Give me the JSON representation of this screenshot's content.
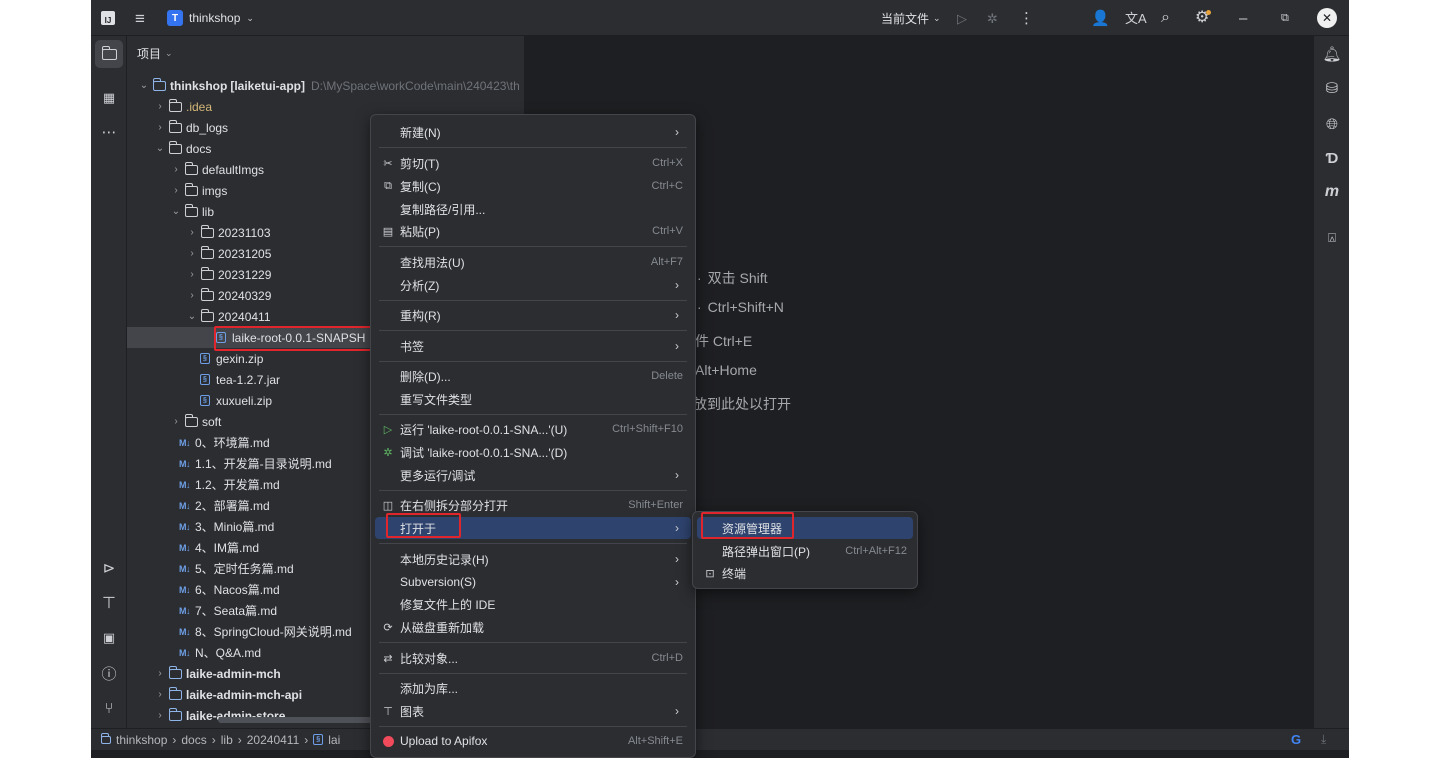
{
  "titlebar": {
    "app_letter": "T",
    "project_name": "thinkshop",
    "run_config": "当前文件"
  },
  "project_panel": {
    "header": "项目",
    "root": {
      "name": "thinkshop",
      "module": "[laiketui-app]",
      "path": "D:\\MySpace\\workCode\\main\\240423\\th"
    },
    "items": [
      {
        "label": ".idea"
      },
      {
        "label": "db_logs"
      },
      {
        "label": "docs"
      },
      {
        "label": "defaultImgs"
      },
      {
        "label": "imgs"
      },
      {
        "label": "lib"
      },
      {
        "label": "20231103"
      },
      {
        "label": "20231205"
      },
      {
        "label": "20231229"
      },
      {
        "label": "20240329"
      },
      {
        "label": "20240411"
      },
      {
        "label": "laike-root-0.0.1-SNAPSH"
      },
      {
        "label": "gexin.zip"
      },
      {
        "label": "tea-1.2.7.jar"
      },
      {
        "label": "xuxueli.zip"
      },
      {
        "label": "soft"
      },
      {
        "label": "0、环境篇.md"
      },
      {
        "label": "1.1、开发篇-目录说明.md"
      },
      {
        "label": "1.2、开发篇.md"
      },
      {
        "label": "2、部署篇.md"
      },
      {
        "label": "3、Minio篇.md"
      },
      {
        "label": "4、IM篇.md"
      },
      {
        "label": "5、定时任务篇.md"
      },
      {
        "label": "6、Nacos篇.md"
      },
      {
        "label": "7、Seata篇.md"
      },
      {
        "label": "8、SpringCloud-网关说明.md"
      },
      {
        "label": "N、Q&A.md"
      },
      {
        "label": "laike-admin-mch"
      },
      {
        "label": "laike-admin-mch-api"
      },
      {
        "label": "laike-admin-store"
      }
    ],
    "md_badge": "M↓"
  },
  "editor_hints": [
    {
      "text": "双击 Shift"
    },
    {
      "text": "Ctrl+Shift+N"
    },
    {
      "text": "件  Ctrl+E"
    },
    {
      "text": "Alt+Home"
    },
    {
      "text": "放到此处以打开"
    }
  ],
  "context_menu": {
    "items": [
      {
        "label": "新建(N)"
      },
      {
        "label": "剪切(T)",
        "shortcut": "Ctrl+X"
      },
      {
        "label": "复制(C)",
        "shortcut": "Ctrl+C"
      },
      {
        "label": "复制路径/引用..."
      },
      {
        "label": "粘贴(P)",
        "shortcut": "Ctrl+V"
      },
      {
        "label": "查找用法(U)",
        "shortcut": "Alt+F7"
      },
      {
        "label": "分析(Z)"
      },
      {
        "label": "重构(R)"
      },
      {
        "label": "书签"
      },
      {
        "label": "删除(D)...",
        "shortcut": "Delete"
      },
      {
        "label": "重写文件类型"
      },
      {
        "label": "运行 'laike-root-0.0.1-SNA...'(U)",
        "shortcut": "Ctrl+Shift+F10"
      },
      {
        "label": "调试 'laike-root-0.0.1-SNA...'(D)"
      },
      {
        "label": "更多运行/调试"
      },
      {
        "label": "在右侧拆分部分打开",
        "shortcut": "Shift+Enter"
      },
      {
        "label": "打开于"
      },
      {
        "label": "本地历史记录(H)"
      },
      {
        "label": "Subversion(S)"
      },
      {
        "label": "修复文件上的 IDE"
      },
      {
        "label": "从磁盘重新加载"
      },
      {
        "label": "比较对象...",
        "shortcut": "Ctrl+D"
      },
      {
        "label": "添加为库..."
      },
      {
        "label": "图表"
      },
      {
        "label": "Upload to Apifox",
        "shortcut": "Alt+Shift+E"
      }
    ]
  },
  "submenu": {
    "items": [
      {
        "label": "资源管理器"
      },
      {
        "label": "路径弹出窗口(P)",
        "shortcut": "Ctrl+Alt+F12"
      },
      {
        "label": "终端"
      }
    ]
  },
  "statusbar": {
    "crumbs": [
      "thinkshop",
      "docs",
      "lib",
      "20240411",
      "lai"
    ]
  },
  "colors": {
    "accent": "#2e436e",
    "highlight_box": "#e0262c",
    "panel_bg": "#2b2d30",
    "editor_bg": "#1e1f22"
  }
}
